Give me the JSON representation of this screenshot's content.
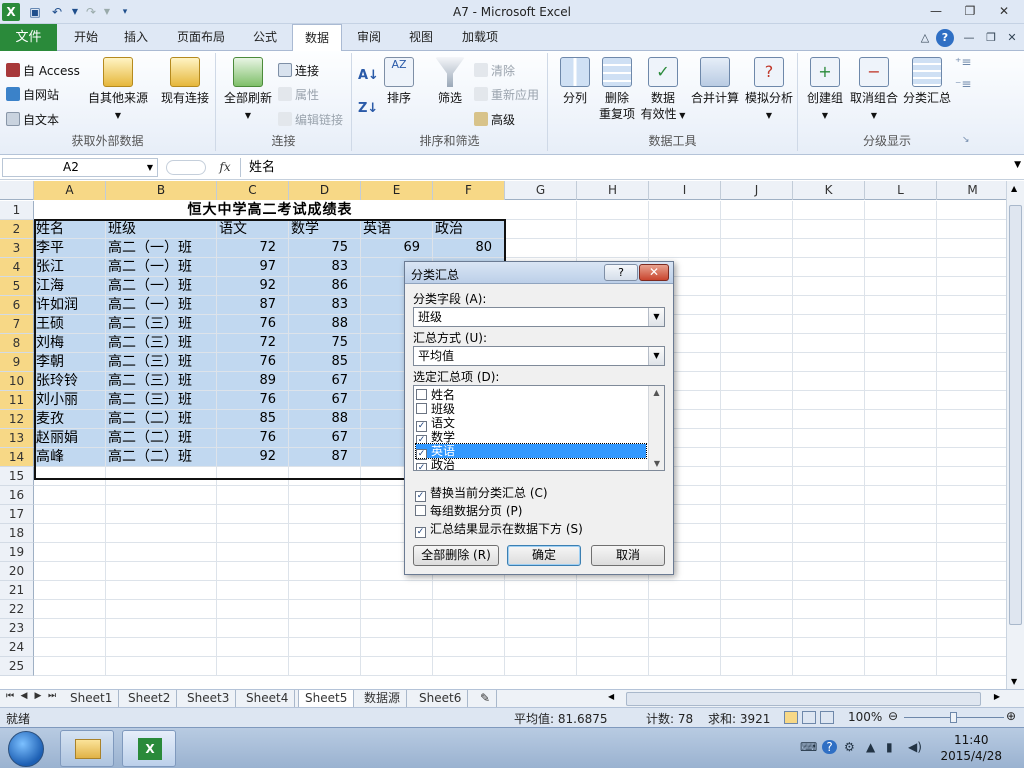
{
  "window": {
    "title": "A7  -  Microsoft Excel",
    "controls": [
      "—",
      "❐",
      "✕"
    ],
    "doc_controls": [
      "—",
      "❐",
      "✕"
    ]
  },
  "ribbon_tabs": [
    "文件",
    "开始",
    "插入",
    "页面布局",
    "公式",
    "数据",
    "审阅",
    "视图",
    "加载项"
  ],
  "active_tab": "数据",
  "ribbon": {
    "external": {
      "items": [
        "自 Access",
        "自网站",
        "自文本"
      ],
      "other_sources": "自其他来源",
      "existing": "现有连接",
      "label": "获取外部数据"
    },
    "connections": {
      "refresh": "全部刷新",
      "items": [
        "连接",
        "属性",
        "编辑链接"
      ],
      "label": "连接"
    },
    "sortfilter": {
      "sort": "排序",
      "filter": "筛选",
      "clear": "清除",
      "reapply": "重新应用",
      "advanced": "高级",
      "label": "排序和筛选"
    },
    "datatools": {
      "split": "分列",
      "dedupe": [
        "删除",
        "重复项"
      ],
      "validation": [
        "数据",
        "有效性"
      ],
      "consolidate": "合并计算",
      "whatif": "模拟分析",
      "label": "数据工具"
    },
    "outline": {
      "group": "创建组",
      "ungroup": "取消组合",
      "subtotal": "分类汇总",
      "label": "分级显示"
    }
  },
  "formula_bar": {
    "name_box": "A2",
    "fx": "fx",
    "value": "姓名"
  },
  "sheet": {
    "columns": [
      "A",
      "B",
      "C",
      "D",
      "E",
      "F",
      "G",
      "H",
      "I",
      "J",
      "K",
      "L",
      "M"
    ],
    "row_numbers": [
      "1",
      "2",
      "3",
      "4",
      "5",
      "6",
      "7",
      "8",
      "9",
      "10",
      "11",
      "12",
      "13",
      "14",
      "15",
      "16",
      "17",
      "18",
      "19",
      "20",
      "21",
      "22",
      "23",
      "24",
      "25"
    ],
    "title": "恒大中学高二考试成绩表",
    "headers": [
      "姓名",
      "班级",
      "语文",
      "数学",
      "英语",
      "政治"
    ],
    "rows": [
      [
        "李平",
        "高二（一）班",
        "72",
        "75",
        "69",
        "80"
      ],
      [
        "张江",
        "高二（一）班",
        "97",
        "83",
        "",
        ""
      ],
      [
        "江海",
        "高二（一）班",
        "92",
        "86",
        "",
        ""
      ],
      [
        "许如润",
        "高二（一）班",
        "87",
        "83",
        "",
        ""
      ],
      [
        "王硕",
        "高二（三）班",
        "76",
        "88",
        "",
        ""
      ],
      [
        "刘梅",
        "高二（三）班",
        "72",
        "75",
        "",
        ""
      ],
      [
        "李朝",
        "高二（三）班",
        "76",
        "85",
        "",
        ""
      ],
      [
        "张玲铃",
        "高二（三）班",
        "89",
        "67",
        "",
        ""
      ],
      [
        "刘小丽",
        "高二（三）班",
        "76",
        "67",
        "",
        ""
      ],
      [
        "麦孜",
        "高二（二）班",
        "85",
        "88",
        "",
        ""
      ],
      [
        "赵丽娟",
        "高二（二）班",
        "76",
        "67",
        "",
        ""
      ],
      [
        "高峰",
        "高二（二）班",
        "92",
        "87",
        "",
        ""
      ]
    ]
  },
  "sheet_tabs": [
    "Sheet1",
    "Sheet2",
    "Sheet3",
    "Sheet4",
    "Sheet5",
    "数据源",
    "Sheet6"
  ],
  "active_sheet": "Sheet5",
  "status": {
    "ready": "就绪",
    "average": "平均值: 81.6875",
    "count": "计数: 78",
    "sum": "求和: 3921",
    "zoom": "100%"
  },
  "dialog": {
    "title": "分类汇总",
    "help": "?",
    "close": "✕",
    "field_label": "分类字段 (A):",
    "field_value": "班级",
    "method_label": "汇总方式 (U):",
    "method_value": "平均值",
    "items_label": "选定汇总项 (D):",
    "items": [
      {
        "label": "姓名",
        "checked": false
      },
      {
        "label": "班级",
        "checked": false
      },
      {
        "label": "语文",
        "checked": true
      },
      {
        "label": "数学",
        "checked": true
      },
      {
        "label": "英语",
        "checked": true
      },
      {
        "label": "政治",
        "checked": true
      }
    ],
    "selected_item": "英语",
    "options": [
      {
        "label": "替换当前分类汇总 (C)",
        "checked": true
      },
      {
        "label": "每组数据分页 (P)",
        "checked": false
      },
      {
        "label": "汇总结果显示在数据下方 (S)",
        "checked": true
      }
    ],
    "buttons": {
      "remove_all": "全部删除 (R)",
      "ok": "确定",
      "cancel": "取消"
    }
  },
  "taskbar": {
    "time": "11:40",
    "date": "2015/4/28"
  },
  "colors": {
    "selection": "#c1d8f0",
    "header_highlight": "#f7d886",
    "file_tab": "#2a8a3a"
  }
}
